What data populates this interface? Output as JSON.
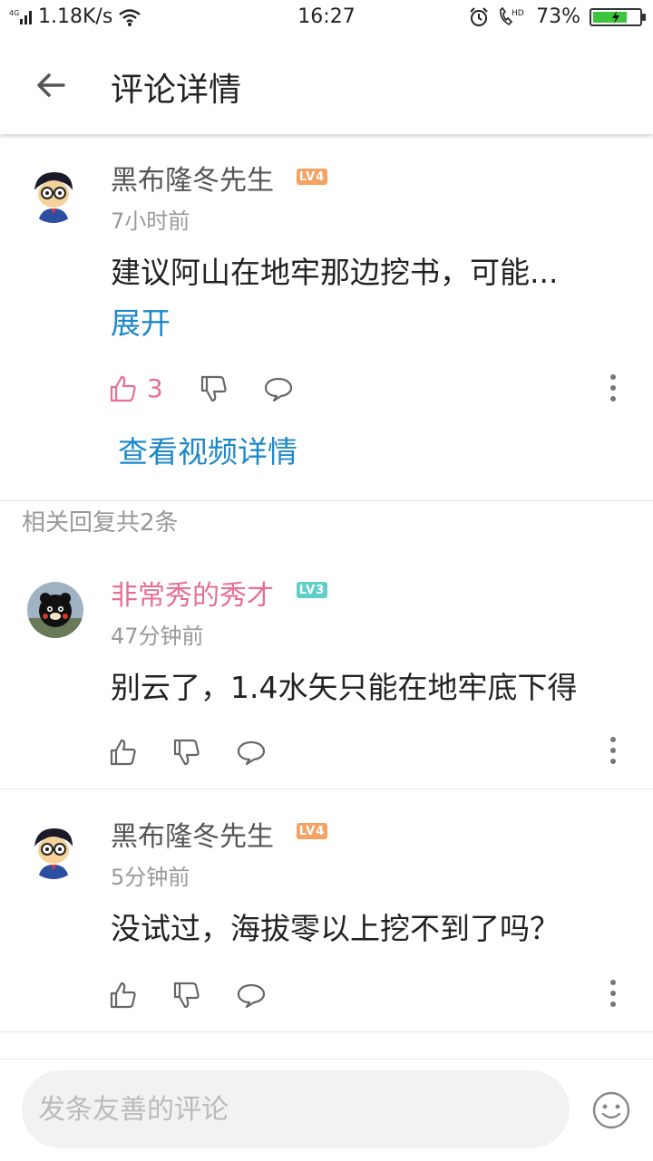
{
  "status_bar": {
    "network": "4G",
    "speed": "1.18K/s",
    "time": "16:27",
    "hd": "HD",
    "battery": "73%",
    "battery_level": 0.73
  },
  "header": {
    "title": "评论详情",
    "back_icon": "arrow-left-icon"
  },
  "main_comment": {
    "username": "黑布隆冬先生",
    "level": "LV4",
    "time": "7小时前",
    "text": "建议阿山在地牢那边挖书，可能...",
    "expand_label": "展开",
    "likes": "3",
    "liked": true,
    "view_video_label": "查看视频详情"
  },
  "replies_label": "相关回复共2条",
  "replies": [
    {
      "username": "非常秀的秀才",
      "level": "LV3",
      "time": "47分钟前",
      "text": "别云了，1.4水矢只能在地牢底下得"
    },
    {
      "username": "黑布隆冬先生",
      "level": "LV4",
      "time": "5分钟前",
      "text": "没试过，海拔零以上挖不到了吗？"
    }
  ],
  "colors": {
    "accent_blue": "#1e88c8",
    "like_pink": "#e86f94",
    "lv4_orange": "#f5a263",
    "lv3_teal": "#5fd0c9"
  },
  "bottom_bar": {
    "input_placeholder": "发条友善的评论",
    "emoji_icon": "smile-icon"
  }
}
